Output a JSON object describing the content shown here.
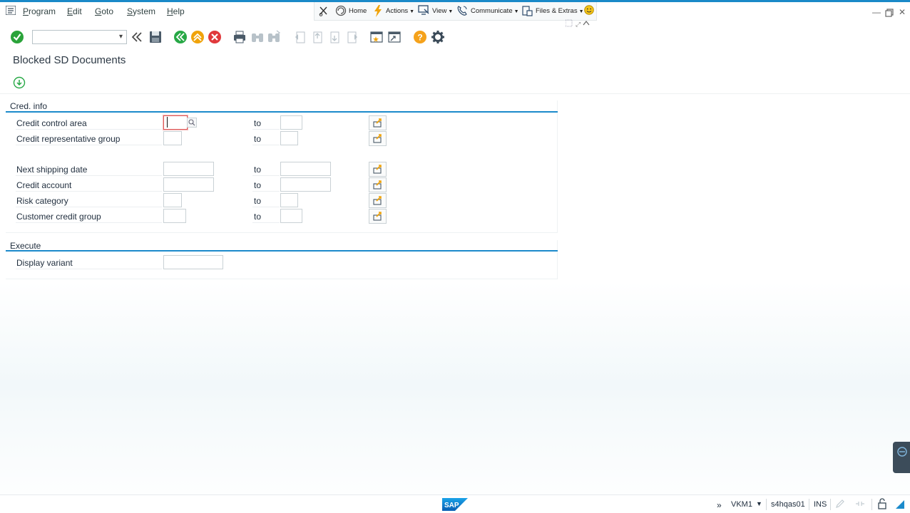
{
  "menubar": {
    "items": [
      {
        "label": "Program",
        "mnemonic": "P"
      },
      {
        "label": "Edit",
        "mnemonic": "E"
      },
      {
        "label": "Goto",
        "mnemonic": "G"
      },
      {
        "label": "System",
        "mnemonic": "S"
      },
      {
        "label": "Help",
        "mnemonic": "H"
      }
    ]
  },
  "commandbar": {
    "home": "Home",
    "actions": "Actions",
    "view": "View",
    "communicate": "Communicate",
    "files_extras": "Files & Extras"
  },
  "page": {
    "title": "Blocked SD Documents"
  },
  "groups": {
    "cred_info": {
      "title": "Cred. info",
      "fields": [
        {
          "label": "Credit control area",
          "to": "to"
        },
        {
          "label": "Credit representative group",
          "to": "to"
        },
        {
          "label": "Next shipping date",
          "to": "to"
        },
        {
          "label": "Credit account",
          "to": "to"
        },
        {
          "label": "Risk category",
          "to": "to"
        },
        {
          "label": "Customer credit group",
          "to": "to"
        }
      ]
    },
    "execute": {
      "title": "Execute",
      "fields": [
        {
          "label": "Display variant"
        }
      ]
    }
  },
  "statusbar": {
    "transaction": "VKM1",
    "server": "s4hqas01",
    "mode": "INS",
    "logo": "SAP"
  },
  "colors": {
    "accent_blue": "#1b8acb",
    "confirm_green": "#2aa33a",
    "nav_green": "#27a845",
    "nav_orange": "#f0a30a",
    "cancel_red": "#e0383b",
    "help_orange": "#f5a21b",
    "focus_red": "#e05c5c"
  }
}
